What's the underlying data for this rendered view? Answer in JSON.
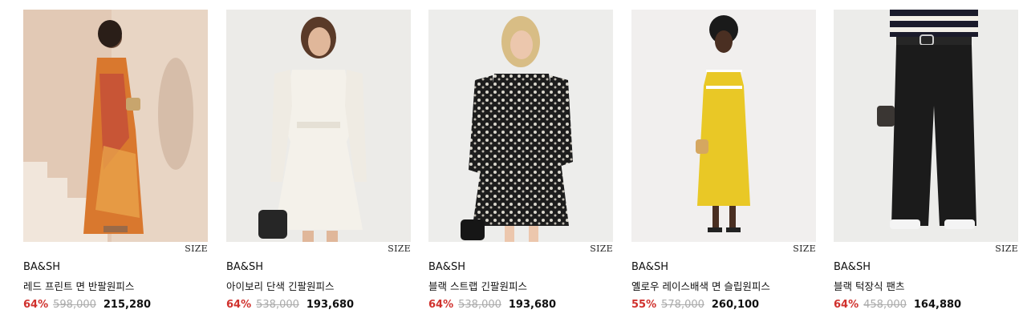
{
  "products": [
    {
      "size_label": "SIZE",
      "brand": "BA&SH",
      "name": "레드 프린트 면 반팔원피스",
      "discount": "64%",
      "original_price": "598,000",
      "price": "215,280",
      "bg": "#e6d2c2",
      "garment": "#d9782e"
    },
    {
      "size_label": "SIZE",
      "brand": "BA&SH",
      "name": "아이보리 단색 긴팔원피스",
      "discount": "64%",
      "original_price": "538,000",
      "price": "193,680",
      "bg": "#ecebe8",
      "garment": "#f4f1ea"
    },
    {
      "size_label": "SIZE",
      "brand": "BA&SH",
      "name": "블랙 스트랩 긴팔원피스",
      "discount": "64%",
      "original_price": "538,000",
      "price": "193,680",
      "bg": "#ededeb",
      "garment": "#1d1d1d"
    },
    {
      "size_label": "SIZE",
      "brand": "BA&SH",
      "name": "옐로우 레이스배색 면 슬립원피스",
      "discount": "55%",
      "original_price": "578,000",
      "price": "260,100",
      "bg": "#f1efee",
      "garment": "#e9c826"
    },
    {
      "size_label": "SIZE",
      "brand": "BA&SH",
      "name": "블랙 턱장식 팬츠",
      "discount": "64%",
      "original_price": "458,000",
      "price": "164,880",
      "bg": "#ececea",
      "garment": "#1b1b1b"
    }
  ]
}
